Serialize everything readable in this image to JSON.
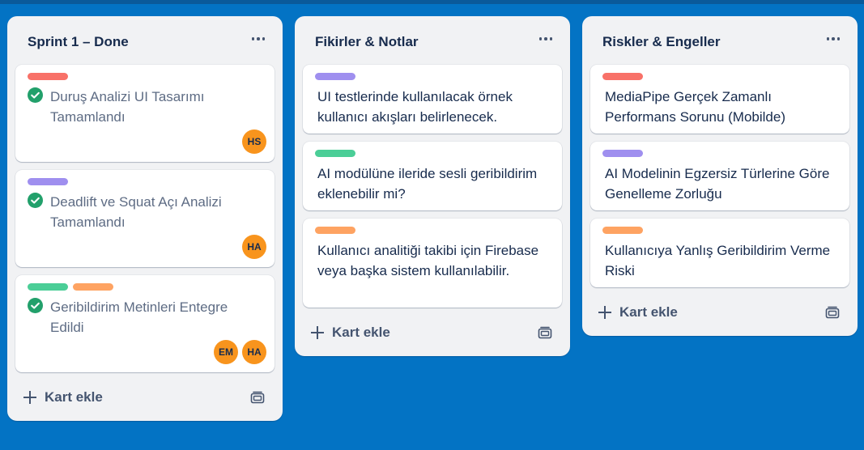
{
  "lists": [
    {
      "title": "Sprint 1 – Done",
      "cards": [
        {
          "text": "Duruş Analizi UI Tasarımı Tamamlandı",
          "labels": [
            "#f87168"
          ],
          "done": true,
          "members": [
            "HS"
          ]
        },
        {
          "text": "Deadlift ve Squat Açı Analizi Tamamlandı",
          "labels": [
            "#9f8fef"
          ],
          "done": true,
          "members": [
            "HA"
          ]
        },
        {
          "text": "Geribildirim Metinleri Entegre Edildi",
          "labels": [
            "#4bce97",
            "#fea362"
          ],
          "done": true,
          "members": [
            "EM",
            "HA"
          ]
        }
      ],
      "add_label": "Kart ekle"
    },
    {
      "title": "Fikirler & Notlar",
      "cards": [
        {
          "text": "UI testlerinde kullanılacak örnek kullanıcı akışları belirlenecek.",
          "labels": [
            "#9f8fef"
          ]
        },
        {
          "text": "AI modülüne ileride sesli geribildirim eklenebilir mi?",
          "labels": [
            "#4bce97"
          ]
        },
        {
          "text": "Kullanıcı analitiği takibi için Firebase veya başka sistem kullanılabilir.",
          "labels": [
            "#fea362"
          ]
        }
      ],
      "add_label": "Kart ekle"
    },
    {
      "title": "Riskler & Engeller",
      "cards": [
        {
          "text": "MediaPipe Gerçek Zamanlı Performans Sorunu (Mobilde)",
          "labels": [
            "#f87168"
          ]
        },
        {
          "text": "AI Modelinin Egzersiz Türlerine Göre Genelleme Zorluğu",
          "labels": [
            "#9f8fef"
          ]
        },
        {
          "text": "Kullanıcıya Yanlış Geribildirim Verme Riski",
          "labels": [
            "#fea362"
          ]
        }
      ],
      "add_label": "Kart ekle"
    }
  ],
  "colors": {
    "board_background": "#0373c4",
    "check_green": "#22a06b",
    "avatar_orange": "#f8941d"
  }
}
